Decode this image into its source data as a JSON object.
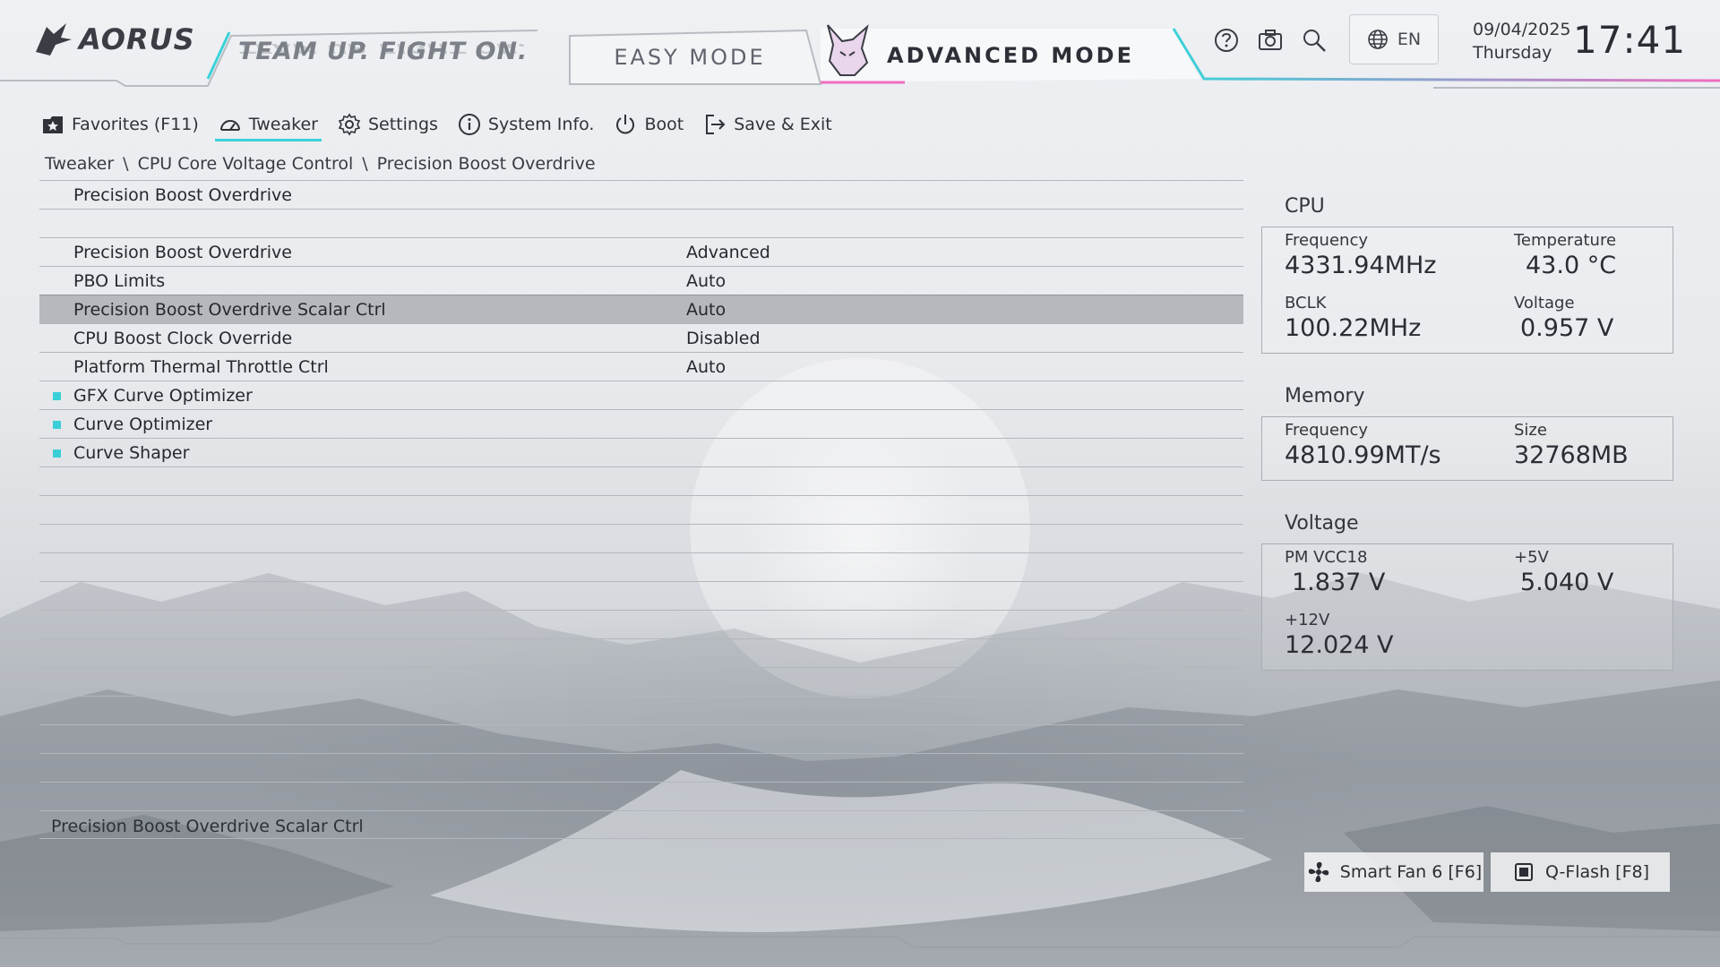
{
  "header": {
    "brand": "AORUS",
    "slogan": "TEAM UP. FIGHT ON.",
    "tabs": [
      {
        "label": "EASY MODE",
        "active": false
      },
      {
        "label": "ADVANCED MODE",
        "active": true
      }
    ],
    "icons": [
      "help-icon",
      "camera-icon",
      "search-icon",
      "globe-icon"
    ],
    "language": "EN",
    "date": "09/04/2025",
    "weekday": "Thursday",
    "time": "17:41",
    "accent_cyan": "#3ad2d8",
    "accent_pink": "#f06cc0"
  },
  "nav": {
    "items": [
      {
        "label": "Favorites (F11)",
        "icon": "favorites-icon",
        "active": false
      },
      {
        "label": "Tweaker",
        "icon": "speedometer-icon",
        "active": true
      },
      {
        "label": "Settings",
        "icon": "gear-icon",
        "active": false
      },
      {
        "label": "System Info.",
        "icon": "info-icon",
        "active": false
      },
      {
        "label": "Boot",
        "icon": "power-icon",
        "active": false
      },
      {
        "label": "Save & Exit",
        "icon": "exit-icon",
        "active": false
      }
    ]
  },
  "breadcrumb": [
    "Tweaker",
    "CPU Core Voltage Control",
    "Precision Boost Overdrive"
  ],
  "list": {
    "rows": [
      {
        "label": "Precision Boost Overdrive",
        "value": "",
        "bullet": false,
        "selected": false
      },
      {
        "label": "",
        "value": "",
        "bullet": false,
        "selected": false
      },
      {
        "label": "Precision Boost Overdrive",
        "value": "Advanced",
        "bullet": false,
        "selected": false
      },
      {
        "label": "PBO Limits",
        "value": "Auto",
        "bullet": false,
        "selected": false
      },
      {
        "label": "Precision Boost Overdrive Scalar Ctrl",
        "value": "Auto",
        "bullet": false,
        "selected": true
      },
      {
        "label": "CPU Boost Clock Override",
        "value": "Disabled",
        "bullet": false,
        "selected": false
      },
      {
        "label": "Platform Thermal Throttle Ctrl",
        "value": "Auto",
        "bullet": false,
        "selected": false
      },
      {
        "label": "GFX Curve Optimizer",
        "value": "",
        "bullet": true,
        "selected": false
      },
      {
        "label": "Curve Optimizer",
        "value": "",
        "bullet": true,
        "selected": false
      },
      {
        "label": "Curve Shaper",
        "value": "",
        "bullet": true,
        "selected": false
      }
    ],
    "empty_rows": 13,
    "bullet_color": "#39cfd6"
  },
  "help_text": "Precision Boost Overdrive Scalar Ctrl",
  "panel": {
    "cpu": {
      "title": "CPU",
      "frequency_label": "Frequency",
      "frequency": "4331.94MHz",
      "temperature_label": "Temperature",
      "temperature": "43.0 °C",
      "bclk_label": "BCLK",
      "bclk": "100.22MHz",
      "voltage_label": "Voltage",
      "voltage": "0.957 V"
    },
    "memory": {
      "title": "Memory",
      "frequency_label": "Frequency",
      "frequency": "4810.99MT/s",
      "size_label": "Size",
      "size": "32768MB"
    },
    "voltage": {
      "title": "Voltage",
      "pm_vcc18_label": "PM VCC18",
      "pm_vcc18": "1.837 V",
      "v5_label": "+5V",
      "v5": "5.040 V",
      "v12_label": "+12V",
      "v12": "12.024 V"
    }
  },
  "bottom": {
    "smart_fan": "Smart Fan 6 [F6]",
    "qflash": "Q-Flash [F8]"
  }
}
